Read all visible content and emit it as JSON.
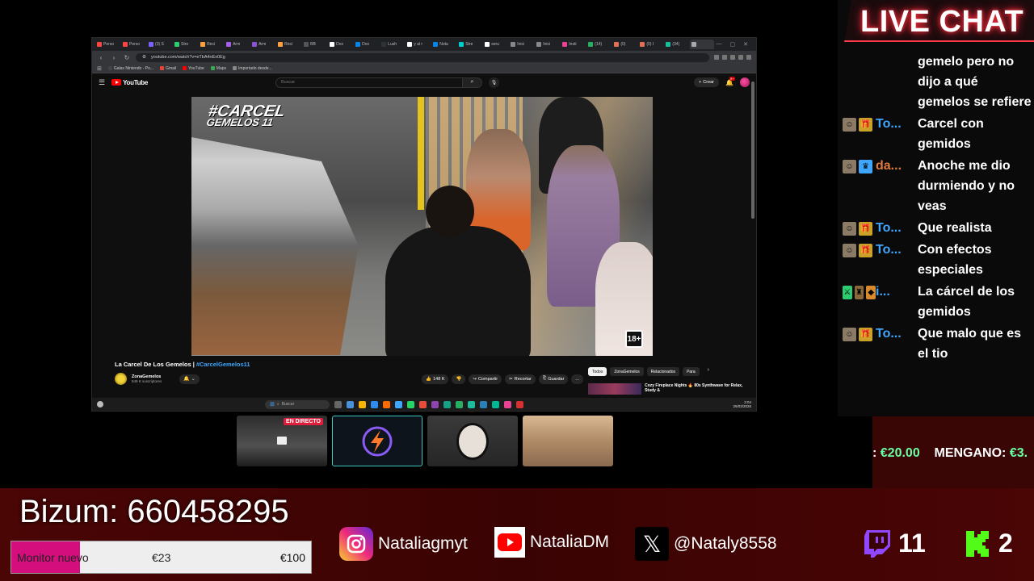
{
  "browser": {
    "tabs": [
      "Perso",
      "Perso",
      "(3) S",
      "Stro",
      "Reci",
      "Arm",
      "Arm",
      "Reci",
      "BB",
      "Dox",
      "Dox",
      "Lush",
      "y al r",
      "Nota",
      "Stre",
      "seru",
      "Inici",
      "Inici",
      "Insti",
      "(14)",
      "(0)",
      "(0) I",
      "(34)",
      ""
    ],
    "url": "youtube.com/watch?v=eTbA4nEx0Eg",
    "bookmarks": [
      "Galas Nintendo - Po...",
      "Gmail",
      "YouTube",
      "Maps",
      "Importado desde..."
    ]
  },
  "youtube": {
    "logo_text": "YouTube",
    "search_placeholder": "Buscar",
    "create_label": "Crear",
    "notifications_badge": "9+",
    "video_overlay_title_1": "#CARCEL",
    "video_overlay_title_2": "GEMELOS 11",
    "rating": "18+",
    "video_title": "La Carcel De Los Gemelos | ",
    "video_hashtag": "#CarcelGemelos11",
    "channel_name": "ZonaGemelos",
    "channel_subs": "849 K suscriptores",
    "likes": "148 K",
    "share_label": "Compartir",
    "clip_label": "Recortar",
    "save_label": "Guardar",
    "more_label": "...",
    "chips": [
      "Todos",
      "ZonaGemelos",
      "Relacionados",
      "Para"
    ],
    "rec_title": "Cozy Fireplace Nights 🔥 80s Synthwave for Relax, Study &"
  },
  "taskbar": {
    "search_label": "Buscar",
    "time": "2:04",
    "date": "26/03/2026"
  },
  "chat": {
    "title": "LIVE CHAT",
    "messages": [
      {
        "user": "",
        "user_color": "blue",
        "badges": [],
        "text": "gemelo pero no dijo a qué gemelos se refiere"
      },
      {
        "user": "To...",
        "user_color": "blue",
        "badges": [
          "avatar-badge",
          "gift-badge"
        ],
        "text": "Carcel con gemidos"
      },
      {
        "user": "da...",
        "user_color": "orange",
        "badges": [
          "avatar-badge",
          "crown-badge"
        ],
        "text": "Anoche me dio durmiendo y no veas"
      },
      {
        "user": "To...",
        "user_color": "blue",
        "badges": [
          "avatar-badge",
          "gift-badge"
        ],
        "text": "Que realista"
      },
      {
        "user": "To...",
        "user_color": "blue",
        "badges": [
          "avatar-badge",
          "gift-badge"
        ],
        "text": "Con efectos especiales"
      },
      {
        "user": "i...",
        "user_color": "blue",
        "badges": [
          "sword-badge",
          "vip-badge",
          "gem-badge"
        ],
        "text": "La cárcel de los gemidos"
      },
      {
        "user": "To...",
        "user_color": "blue",
        "badges": [
          "avatar-badge",
          "gift-badge"
        ],
        "text": "Que malo que es el tio"
      }
    ]
  },
  "donations": {
    "prefix": ": ",
    "first_amount": "€20.00",
    "second_name": "MENGANO: ",
    "second_amount": "€3."
  },
  "cams": {
    "live_label": "EN DIRECTO"
  },
  "overlay": {
    "bizum": "Bizum: 660458295",
    "goal_label": "Monitor nuevo",
    "goal_current": "€23",
    "goal_target": "€100",
    "goal_fraction": 0.23,
    "instagram": "Nataliagmyt",
    "youtube": "NataliaDM",
    "x": "@Nataly8558",
    "twitch_count": "11",
    "kick_count": "2"
  },
  "colors": {
    "chat_glow": "#ff3a4a",
    "username_blue": "#3ea6ff",
    "username_orange": "#e07a3a",
    "donation_green": "#6bffa3",
    "goal_fill": "#d40f7d",
    "bottom_bar": "#4a0505",
    "twitch": "#9146ff",
    "kick": "#53fc18"
  }
}
